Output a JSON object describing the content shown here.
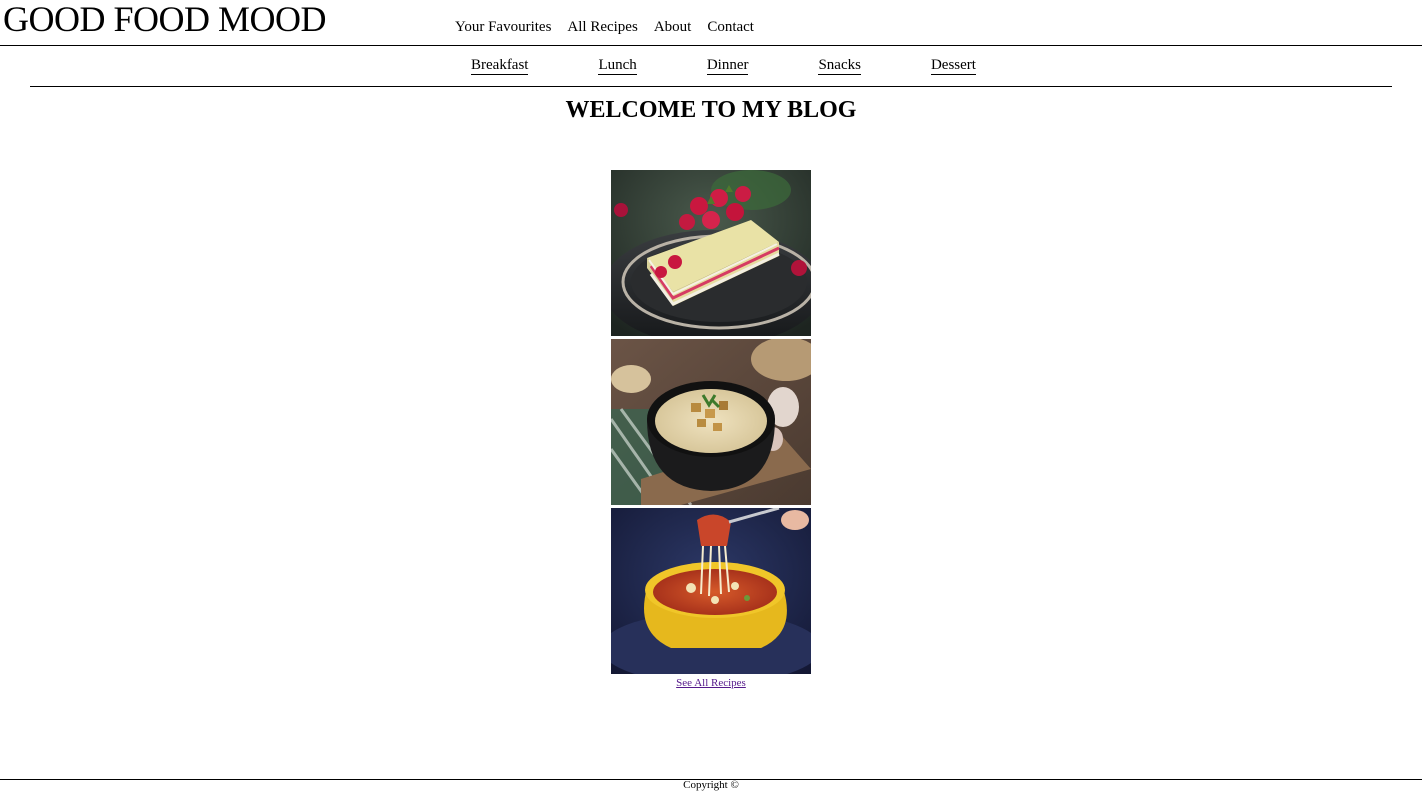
{
  "header": {
    "logo": "GOOD FOOD MOOD",
    "nav": [
      "Your Favourites",
      "All Recipes",
      "About",
      "Contact"
    ]
  },
  "categories": [
    "Breakfast",
    "Lunch",
    "Dinner",
    "Snacks",
    "Dessert"
  ],
  "main": {
    "title": "WELCOME TO MY BLOG",
    "images": [
      "raspberry-cake-photo",
      "soup-bowl-photo",
      "lasagna-photo"
    ],
    "see_all_link": "See All Recipes"
  },
  "footer": {
    "copyright": "Copyright ©"
  },
  "colors": {
    "text": "#000000",
    "visited_link": "#551a8b",
    "background": "#ffffff"
  }
}
